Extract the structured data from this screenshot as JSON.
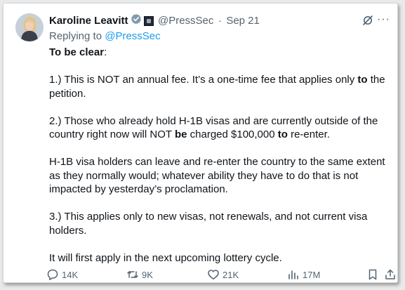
{
  "tweet": {
    "author_name": "Karoline Leavitt",
    "handle": "@PressSec",
    "separator": "·",
    "date": "Sep 21",
    "replying_prefix": "Replying to ",
    "replying_handle": "@PressSec",
    "paragraphs": [
      [
        {
          "t": "To be clear",
          "b": true
        },
        {
          "t": ":",
          "b": false
        }
      ],
      [
        {
          "t": "1.) This is NOT an annual fee. It’s a one-time fee that applies only ",
          "b": false
        },
        {
          "t": "to",
          "b": true
        },
        {
          "t": " the petition.",
          "b": false
        }
      ],
      [
        {
          "t": "2.) Those who already hold H-1B visas and are currently outside of the country right now will NOT ",
          "b": false
        },
        {
          "t": "be",
          "b": true
        },
        {
          "t": " charged $100,000 ",
          "b": false
        },
        {
          "t": "to",
          "b": true
        },
        {
          "t": " re-enter.",
          "b": false
        }
      ],
      [
        {
          "t": "H-1B visa holders can leave and re-enter the country to the same extent as they normally would; whatever ability they have to do that is not impacted by yesterday’s proclamation.",
          "b": false
        }
      ],
      [
        {
          "t": "3.) This applies only to new visas, not renewals, and not current visa holders.",
          "b": false
        }
      ],
      [
        {
          "t": "It will first apply in the next upcoming lottery cycle.",
          "b": false
        }
      ]
    ],
    "stats": {
      "replies": "14K",
      "reposts": "9K",
      "likes": "21K",
      "views": "17M"
    }
  },
  "icons": {
    "verified": "verified-badge-icon",
    "affiliate": "government-affiliate-icon",
    "grok": "grok-icon",
    "more": "more-icon",
    "reply": "reply-icon",
    "repost": "repost-icon",
    "like": "like-icon",
    "views": "views-icon",
    "bookmark": "bookmark-icon",
    "share": "share-icon"
  },
  "colors": {
    "link": "#1d9bf0",
    "muted": "#536471",
    "text": "#0f1419",
    "verified": "#829aab"
  }
}
